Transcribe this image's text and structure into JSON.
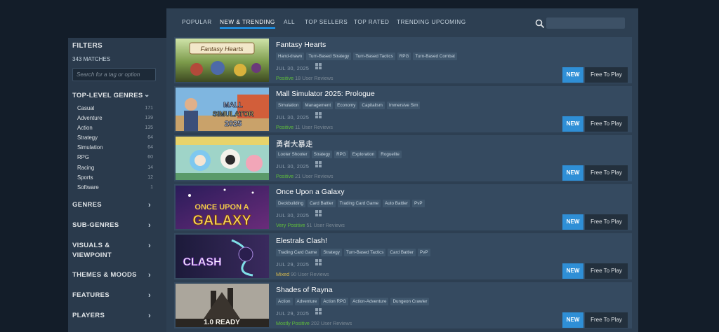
{
  "filters": {
    "title": "FILTERS",
    "matches": "343 MATCHES",
    "search_placeholder": "Search for a tag or option",
    "top_level_genres": {
      "label": "TOP-LEVEL GENRES",
      "items": [
        {
          "label": "Casual",
          "count": "171"
        },
        {
          "label": "Adventure",
          "count": "139"
        },
        {
          "label": "Action",
          "count": "135"
        },
        {
          "label": "Strategy",
          "count": "64"
        },
        {
          "label": "Simulation",
          "count": "64"
        },
        {
          "label": "RPG",
          "count": "60"
        },
        {
          "label": "Racing",
          "count": "14"
        },
        {
          "label": "Sports",
          "count": "12"
        },
        {
          "label": "Software",
          "count": "1"
        }
      ]
    },
    "sections": [
      "GENRES",
      "SUB-GENRES",
      "VISUALS & VIEWPOINT",
      "THEMES & MOODS",
      "FEATURES",
      "PLAYERS"
    ]
  },
  "tabs": [
    "POPULAR",
    "NEW & TRENDING",
    "ALL",
    "TOP SELLERS",
    "TOP RATED",
    "TRENDING UPCOMING"
  ],
  "active_tab": "NEW & TRENDING",
  "icons": {
    "search": "search-icon",
    "chevron": "chevron-right-icon",
    "platform": "windows-icon"
  },
  "colors": {
    "accent": "#1a9fff",
    "new_badge": "#2f8fd6",
    "positive": "#5fbe3a",
    "mixed": "#d7b94e"
  },
  "games": [
    {
      "name": "Fantasy Hearts",
      "tags": [
        "Hand-drawn",
        "Turn-Based Strategy",
        "Turn-Based Tactics",
        "RPG",
        "Turn-Based Combat"
      ],
      "date": "JUL 30, 2025",
      "rating": "Positive",
      "rating_class": "pos",
      "reviews": "18 User Reviews",
      "badge": "NEW",
      "price": "Free To Play",
      "cover_text": "Fantasy Hearts"
    },
    {
      "name": "Mall Simulator 2025: Prologue",
      "tags": [
        "Simulation",
        "Management",
        "Economy",
        "Capitalism",
        "Immersive Sim"
      ],
      "date": "JUL 30, 2025",
      "rating": "Positive",
      "rating_class": "pos",
      "reviews": "11 User Reviews",
      "badge": "NEW",
      "price": "Free To Play",
      "cover_text": "MALL SIMULATOR 2025"
    },
    {
      "name": "勇者大暴走",
      "tags": [
        "Looter Shooter",
        "Strategy",
        "RPG",
        "Exploration",
        "Roguelite"
      ],
      "date": "JUL 30, 2025",
      "rating": "Positive",
      "rating_class": "pos",
      "reviews": "21 User Reviews",
      "badge": "NEW",
      "price": "Free To Play",
      "cover_text": ""
    },
    {
      "name": "Once Upon a Galaxy",
      "tags": [
        "Deckbuilding",
        "Card Battler",
        "Trading Card Game",
        "Auto Battler",
        "PvP"
      ],
      "date": "JUL 30, 2025",
      "rating": "Very Positive",
      "rating_class": "pos",
      "reviews": "51 User Reviews",
      "badge": "NEW",
      "price": "Free To Play",
      "cover_text": "ONCE UPON A GALAXY"
    },
    {
      "name": "Elestrals Clash!",
      "tags": [
        "Trading Card Game",
        "Strategy",
        "Turn-Based Tactics",
        "Card Battler",
        "PvP"
      ],
      "date": "JUL 29, 2025",
      "rating": "Mixed",
      "rating_class": "mixed",
      "reviews": "90 User Reviews",
      "badge": "NEW",
      "price": "Free To Play",
      "cover_text": "CLASH"
    },
    {
      "name": "Shades of Rayna",
      "tags": [
        "Action",
        "Adventure",
        "Action RPG",
        "Action-Adventure",
        "Dungeon Crawler"
      ],
      "date": "JUL 29, 2025",
      "rating": "Mostly Positive",
      "rating_class": "pos",
      "reviews": "202 User Reviews",
      "badge": "NEW",
      "price": "Free To Play",
      "cover_text": "1.0 READY"
    }
  ]
}
